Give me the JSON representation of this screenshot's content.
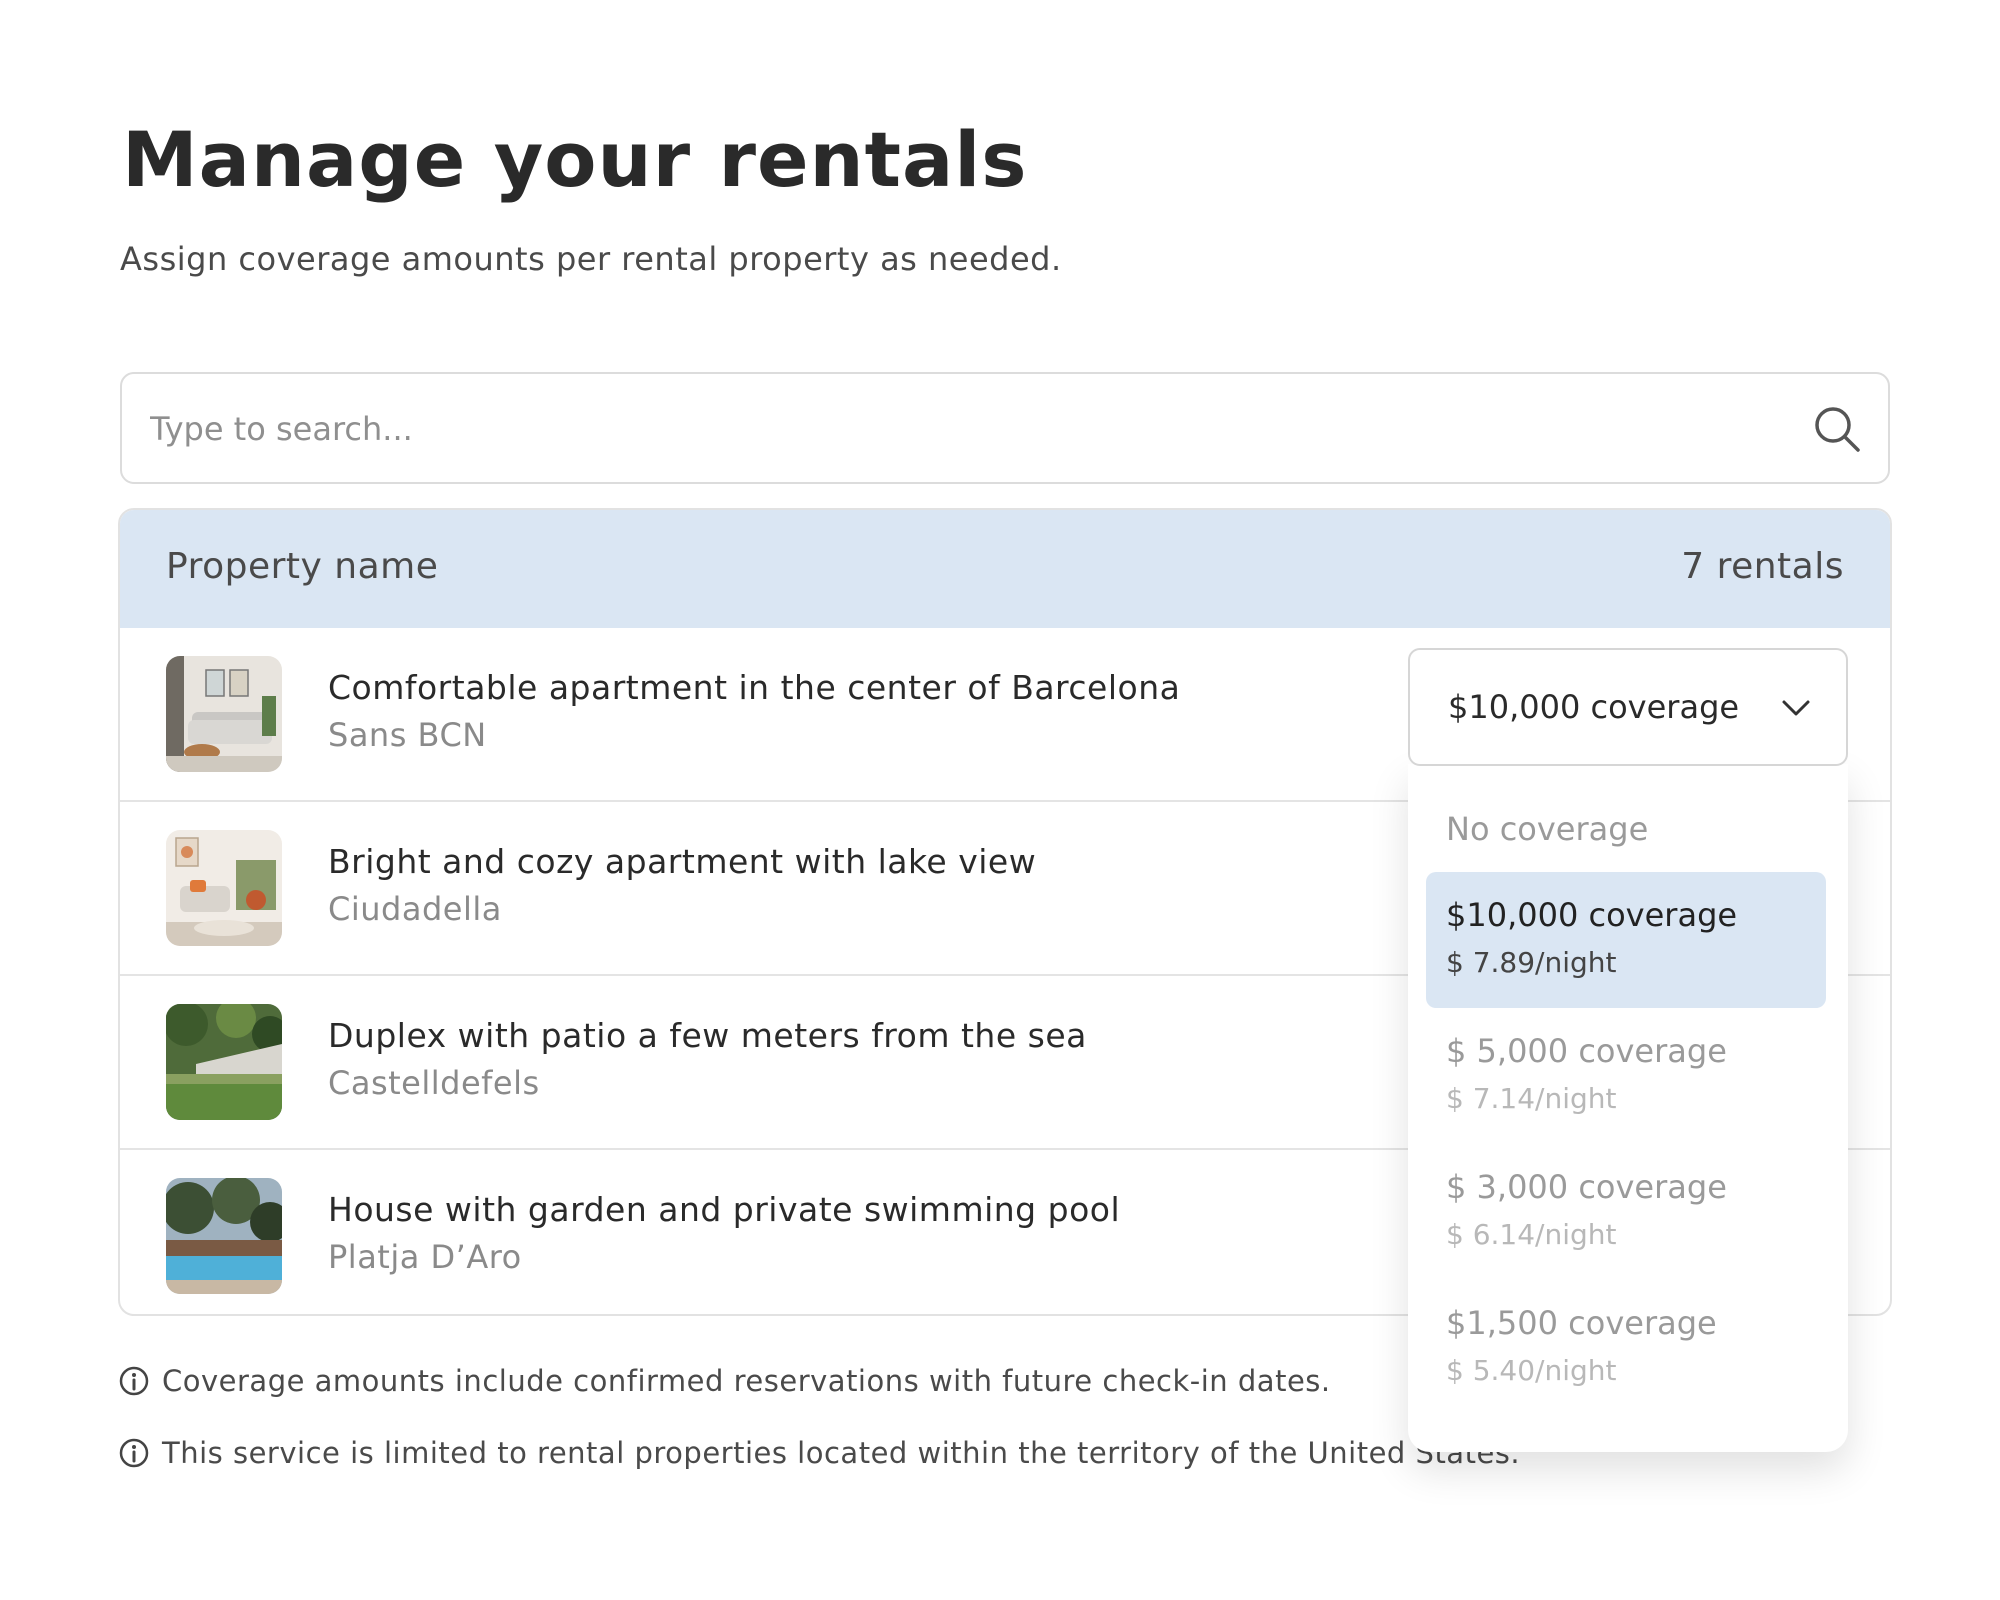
{
  "header": {
    "title": "Manage your rentals",
    "subtitle": "Assign coverage amounts per rental property as needed."
  },
  "search": {
    "placeholder": "Type to search...",
    "icon": "search-icon"
  },
  "table": {
    "column_label": "Property name",
    "count_label": "7 rentals",
    "rows": [
      {
        "name": "Comfortable apartment in the center of Barcelona",
        "location": "Sans BCN",
        "thumb": "living-room-photo"
      },
      {
        "name": "Bright and cozy apartment with lake view",
        "location": "Ciudadella",
        "thumb": "bright-living-room-photo"
      },
      {
        "name": "Duplex with patio a few meters from the sea",
        "location": "Castelldefels",
        "thumb": "patio-garden-photo"
      },
      {
        "name": "House with garden and private swimming pool",
        "location": "Platja D’Aro",
        "thumb": "pool-photo"
      }
    ]
  },
  "coverage_select": {
    "value": "$10,000 coverage",
    "icon": "chevron-down-icon",
    "options": [
      {
        "label": "No coverage",
        "price": ""
      },
      {
        "label": "$10,000 coverage",
        "price": "$ 7.89/night",
        "selected": true
      },
      {
        "label": "$ 5,000 coverage",
        "price": "$ 7.14/night"
      },
      {
        "label": "$ 3,000 coverage",
        "price": "$ 6.14/night"
      },
      {
        "label": "$1,500 coverage",
        "price": "$ 5.40/night"
      }
    ]
  },
  "notes": [
    "Coverage amounts include confirmed reservations with future check-in dates.",
    "This service is limited to rental properties located within the territory of the United States."
  ],
  "colors": {
    "header_bg": "#dae6f3",
    "selected_bg": "#dae6f3",
    "border": "#dcdcdc",
    "muted_text": "#8a8a8a"
  }
}
